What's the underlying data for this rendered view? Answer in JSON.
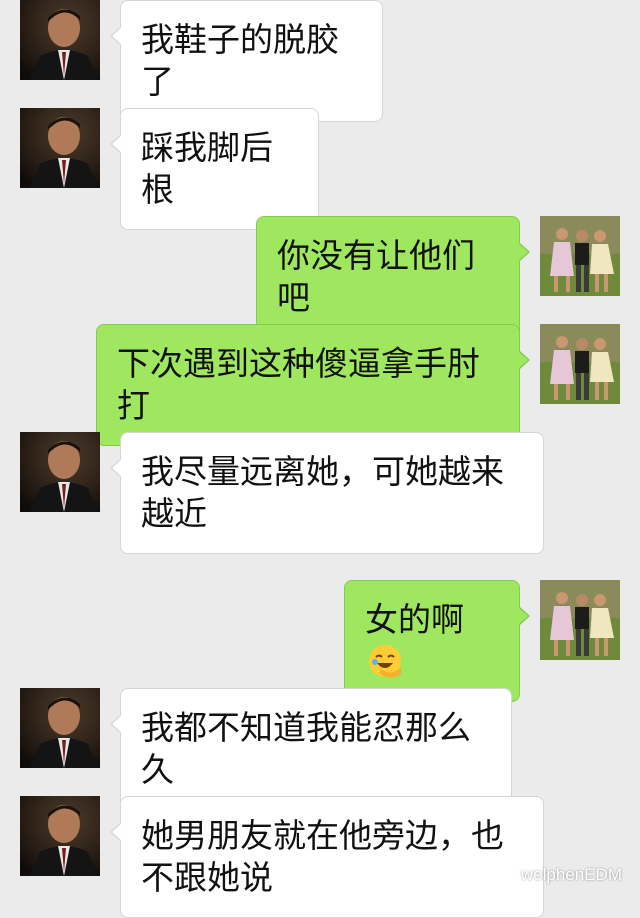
{
  "messages": [
    {
      "side": "left",
      "text": "我鞋子的脱胶了"
    },
    {
      "side": "left",
      "text": "踩我脚后根"
    },
    {
      "side": "right",
      "text": "你没有让他们吧"
    },
    {
      "side": "right",
      "text": "下次遇到这种傻逼拿手肘打"
    },
    {
      "side": "left",
      "text": "我尽量远离她，可她越来越近"
    },
    {
      "side": "right",
      "text": "女的啊",
      "emoji": "face-palm-laughing-emoji"
    },
    {
      "side": "left",
      "text": "我都不知道我能忍那么久"
    },
    {
      "side": "left",
      "text": "她男朋友就在他旁边，也不跟她说"
    }
  ],
  "watermark": {
    "text": "welphenEDM",
    "icon": "wechat-icon"
  },
  "colors": {
    "background": "#ebebeb",
    "incoming_bubble": "#ffffff",
    "outgoing_bubble": "#9fe75f"
  }
}
